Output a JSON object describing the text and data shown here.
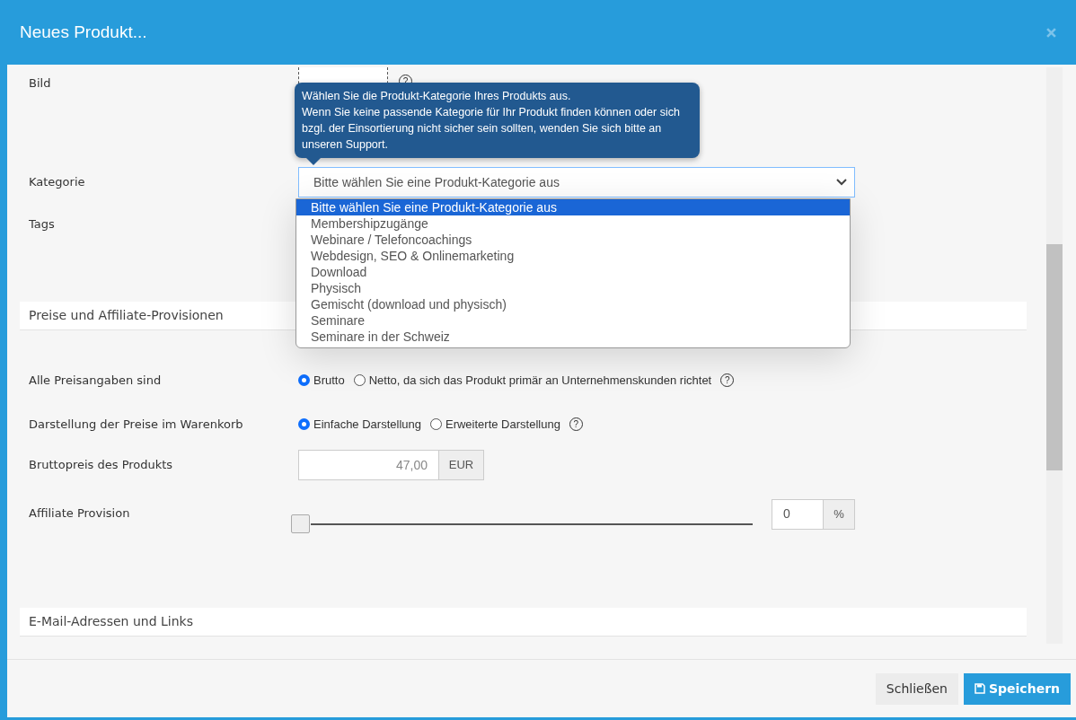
{
  "window": {
    "title": "Neues Produkt..."
  },
  "image": {
    "label": "Bild",
    "help": "?"
  },
  "category": {
    "label": "Kategorie",
    "value": "Bitte wählen Sie eine Produkt-Kategorie aus",
    "tooltip": [
      "Wählen Sie die Produkt-Kategorie Ihres Produkts aus.",
      "Wenn Sie keine passende Kategorie für Ihr Produkt finden können oder sich bzgl. der Einsortierung nicht sicher sein sollten, wenden Sie sich bitte an unseren Support."
    ],
    "options": [
      {
        "label": "Bitte wählen Sie eine Produkt-Kategorie aus",
        "selected": true
      },
      {
        "label": "Membershipzugänge",
        "selected": false
      },
      {
        "label": "Webinare / Telefoncoachings",
        "selected": false
      },
      {
        "label": "Webdesign, SEO & Onlinemarketing",
        "selected": false
      },
      {
        "label": "Download",
        "selected": false
      },
      {
        "label": "Physisch",
        "selected": false
      },
      {
        "label": "Gemischt (download und physisch)",
        "selected": false
      },
      {
        "label": "Seminare",
        "selected": false
      },
      {
        "label": "Seminare in der Schweiz",
        "selected": false
      }
    ]
  },
  "tags": {
    "label": "Tags"
  },
  "section_prices": {
    "title": "Preise und Affiliate-Provisionen"
  },
  "radio_groups": [
    {
      "label": "Alle Preisangaben sind",
      "help": "?",
      "options": [
        {
          "label": "Brutto",
          "selected": true
        },
        {
          "label": "Netto, da sich das Produkt primär an Unternehmenskunden richtet",
          "selected": false
        }
      ]
    },
    {
      "label": "Darstellung der Preise im Warenkorb",
      "help": "?",
      "options": [
        {
          "label": "Einfache Darstellung",
          "selected": true
        },
        {
          "label": "Erweiterte Darstellung",
          "selected": false
        }
      ]
    }
  ],
  "price": {
    "label": "Bruttopreis des Produkts",
    "placeholder": "47,00",
    "unit": "EUR"
  },
  "affiliate": {
    "label": "Affiliate Provision",
    "level": 0,
    "value": "0",
    "unit": "%"
  },
  "section_links": {
    "title": "E-Mail-Adressen und Links"
  },
  "buttons": {
    "close": "Schließen",
    "save": "Speichern"
  }
}
